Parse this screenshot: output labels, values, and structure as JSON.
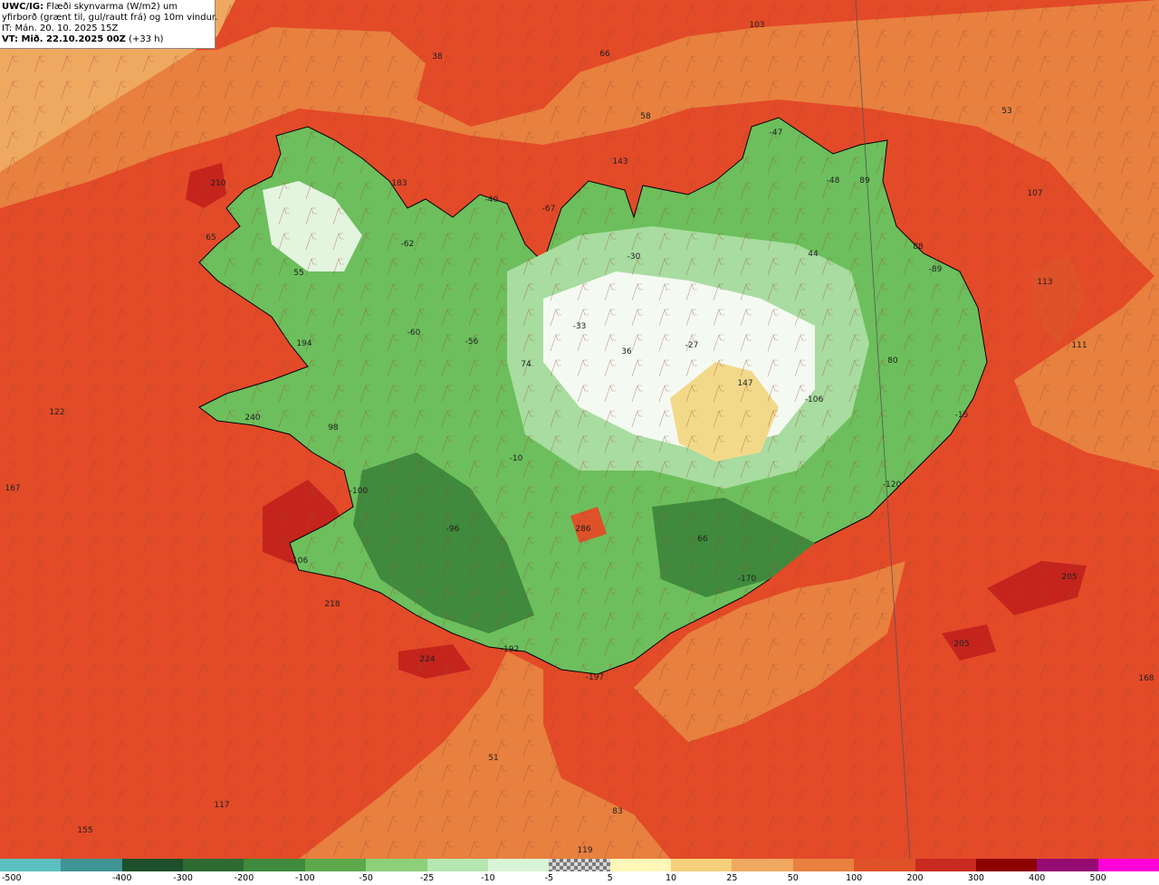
{
  "header": {
    "line1_bold": "UWC/IG:",
    "line1_rest": "Flæði skynvarma (W/m2) um",
    "line2": "yfirborð (grænt til, gul/rautt frá) og 10m vindur.",
    "line3": "IT: Mán. 20. 10. 2025 15Z",
    "line4_bold": "VT: Mið. 22.10.2025 00Z",
    "line4_rest": "(+33 h)"
  },
  "value_labels": [
    "103",
    "38",
    "66",
    "58",
    "53",
    "143",
    "-47",
    "210",
    "183",
    "-40",
    "-67",
    "-48",
    "89",
    "107",
    "65",
    "-62",
    "-30",
    "44",
    "88",
    "55",
    "-89",
    "113",
    "-60",
    "-33",
    "194",
    "-56",
    "36",
    "-27",
    "111",
    "74",
    "80",
    "122",
    "147",
    "-106",
    "240",
    "-15",
    "98",
    "-10",
    "167",
    "-100",
    "-120",
    "-96",
    "286",
    "66",
    "-106",
    "-170",
    "205",
    "218",
    "224",
    "-192",
    "-197",
    "205",
    "168",
    "51",
    "117",
    "83",
    "155",
    "119"
  ],
  "legend": {
    "colors": [
      "#5cbfbf",
      "#3f9494",
      "#1d4f2a",
      "#2e6b33",
      "#3f8a3c",
      "#5ea84c",
      "#8cd07a",
      "#b6e6b1",
      "#d9f3d6",
      "checker",
      "#fff6b8",
      "#f6d07a",
      "#f0a860",
      "#e8803f",
      "#de5129",
      "#c82a1f",
      "#8c0000",
      "#960a74",
      "#ff00d8"
    ],
    "ticks": [
      "-500",
      "-400",
      "-300",
      "-200",
      "-100",
      "-50",
      "-25",
      "-10",
      "-5",
      "5",
      "10",
      "25",
      "50",
      "100",
      "200",
      "300",
      "400",
      "500"
    ]
  },
  "colors": {
    "sea_red": "#e34a28",
    "sea_orange": "#e8803f",
    "sea_light_orange": "#efa860",
    "deep_red": "#c4241c",
    "land_green": "#6cbf5c",
    "land_dark_green": "#3f8a3c",
    "land_light_green": "#a8dca0",
    "land_white": "#f4faf2",
    "land_yellow": "#f2d98a"
  }
}
